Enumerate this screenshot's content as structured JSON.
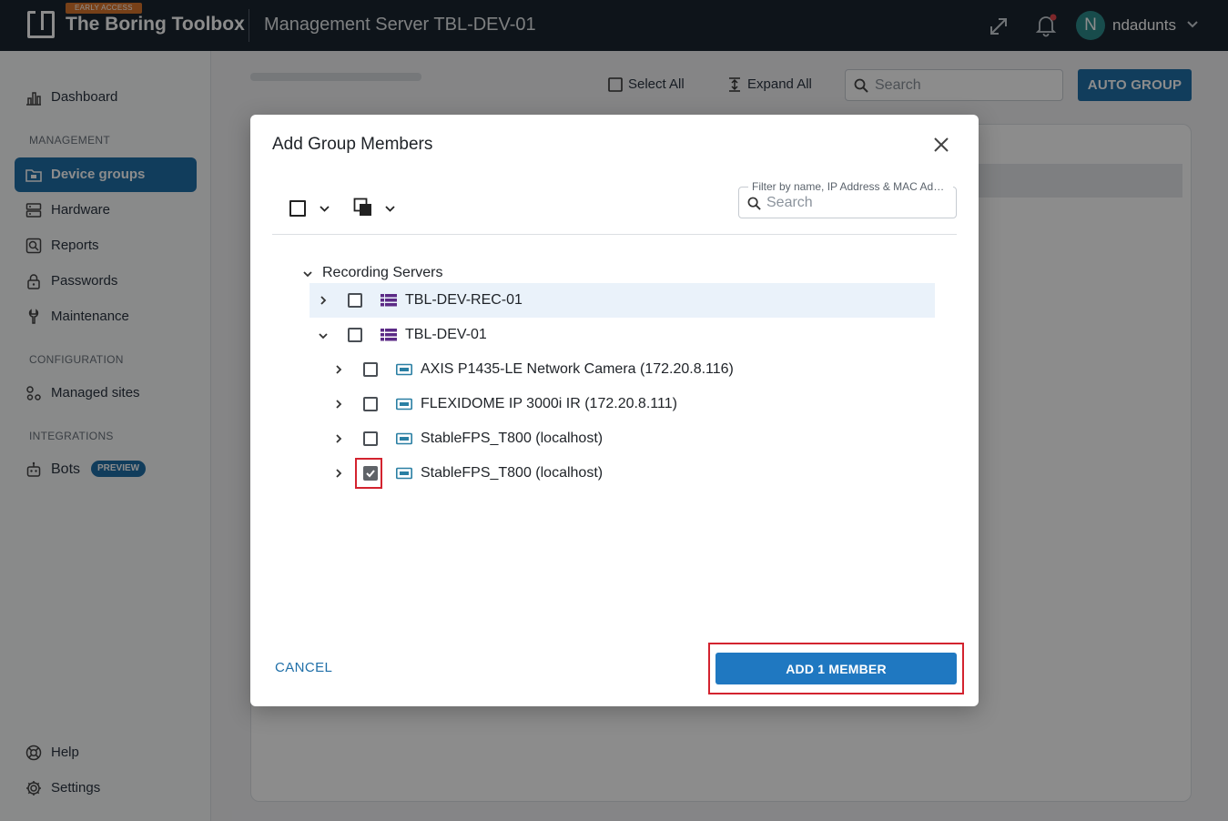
{
  "topbar": {
    "badge": "EARLY ACCESS",
    "app_title": "The Boring Toolbox",
    "server_title": "Management Server TBL-DEV-01",
    "user_initial": "N",
    "user_name": "ndadunts",
    "icons": [
      "expand-icon",
      "bell-icon",
      "chevron-down-icon"
    ],
    "notification_dot_color": "#e5484d"
  },
  "sidebar": {
    "dashboard": "Dashboard",
    "section_management": "MANAGEMENT",
    "device_groups": "Device groups",
    "hardware": "Hardware",
    "reports": "Reports",
    "passwords": "Passwords",
    "maintenance": "Maintenance",
    "section_configuration": "CONFIGURATION",
    "managed_sites": "Managed sites",
    "section_integrations": "INTEGRATIONS",
    "bots": "Bots",
    "bots_badge": "PREVIEW",
    "help": "Help",
    "settings": "Settings",
    "active_item": "Device groups"
  },
  "main": {
    "select_all": "Select All",
    "expand_all": "Expand All",
    "search_placeholder": "Search",
    "auto_group": "AUTO GROUP"
  },
  "dialog": {
    "title": "Add Group Members",
    "filter_label": "Filter by name, IP Address & MAC Address",
    "filter_placeholder": "Search",
    "tree": {
      "root": "Recording Servers",
      "servers": [
        {
          "name": "TBL-DEV-REC-01",
          "expanded": false,
          "checked": false
        },
        {
          "name": "TBL-DEV-01",
          "expanded": true,
          "checked": false
        }
      ],
      "devices": [
        {
          "name": "AXIS P1435-LE Network Camera (172.20.8.116)",
          "checked": false
        },
        {
          "name": "FLEXIDOME IP 3000i IR (172.20.8.111)",
          "checked": false
        },
        {
          "name": "StableFPS_T800 (localhost)",
          "checked": false
        },
        {
          "name": "StableFPS_T800 (localhost)",
          "checked": true
        }
      ]
    },
    "cancel": "CANCEL",
    "add_button": "ADD 1 MEMBER"
  },
  "colors": {
    "primary": "#1f6fa8",
    "topbar_bg": "#1b2530",
    "server_icon": "#5b2a86",
    "camera_icon": "#2a7fa3",
    "highlight": "#d3232f"
  }
}
